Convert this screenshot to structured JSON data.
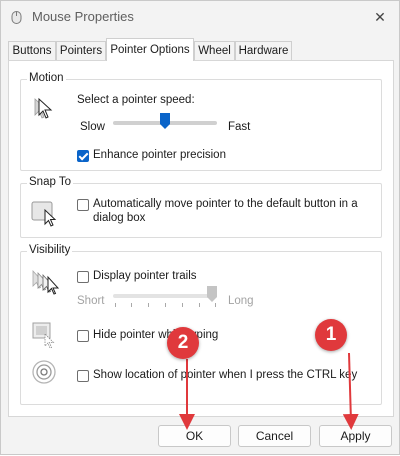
{
  "window": {
    "title": "Mouse Properties",
    "close_glyph": "✕"
  },
  "tabs": [
    {
      "label": "Buttons",
      "active": false
    },
    {
      "label": "Pointers",
      "active": false
    },
    {
      "label": "Pointer Options",
      "active": true
    },
    {
      "label": "Wheel",
      "active": false
    },
    {
      "label": "Hardware",
      "active": false
    }
  ],
  "motion": {
    "group_label": "Motion",
    "speed_label": "Select a pointer speed:",
    "slow_label": "Slow",
    "fast_label": "Fast",
    "speed_level": 0.5,
    "enhance_label": "Enhance pointer precision",
    "enhance_checked": true
  },
  "snap_to": {
    "group_label": "Snap To",
    "auto_move_label_line1": "Automatically move pointer to the default button in a",
    "auto_move_label_line2": "dialog box",
    "auto_move_checked": false
  },
  "visibility": {
    "group_label": "Visibility",
    "trails_label": "Display pointer trails",
    "trails_checked": false,
    "short_label": "Short",
    "long_label": "Long",
    "trails_level": 1.0,
    "hide_label": "Hide pointer while typing",
    "hide_checked": false,
    "ctrl_label": "Show location of pointer when I press the CTRL key",
    "ctrl_checked": false
  },
  "buttons": {
    "ok": "OK",
    "cancel": "Cancel",
    "apply": "Apply"
  },
  "annotations": {
    "badge1": "1",
    "badge2": "2",
    "badge_color": "#e0393c"
  },
  "colors": {
    "accent": "#0a64c9"
  }
}
